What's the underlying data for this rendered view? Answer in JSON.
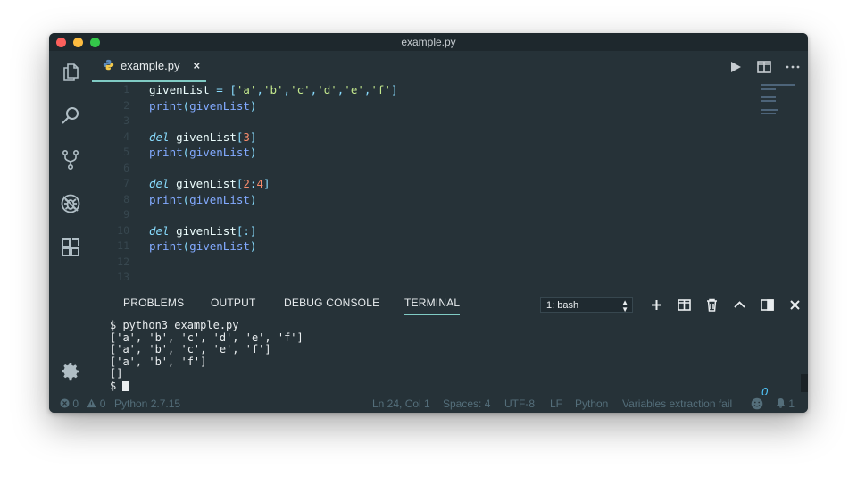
{
  "window": {
    "title": "example.py"
  },
  "activity_bar": {
    "items": [
      "explorer-icon",
      "search-icon",
      "source-control-icon",
      "debug-icon",
      "extensions-icon"
    ],
    "bottom": "settings-gear-icon"
  },
  "tab": {
    "label": "example.py",
    "close": "×"
  },
  "editor": {
    "line_numbers": [
      "1",
      "2",
      "3",
      "4",
      "5",
      "6",
      "7",
      "8",
      "9",
      "10",
      "11",
      "12",
      "13"
    ],
    "lines": [
      "givenList = ['a','b','c','d','e','f']",
      "print(givenList)",
      "",
      "del givenList[3]",
      "print(givenList)",
      "",
      "del givenList[2:4]",
      "print(givenList)",
      "",
      "del givenList[:]",
      "print(givenList)",
      "",
      ""
    ]
  },
  "panel": {
    "tabs": [
      "PROBLEMS",
      "OUTPUT",
      "DEBUG CONSOLE",
      "TERMINAL"
    ],
    "active_tab": "TERMINAL",
    "terminal_select": "1: bash",
    "terminal_lines": [
      "$ python3 example.py",
      "['a', 'b', 'c', 'd', 'e', 'f']",
      "['a', 'b', 'c', 'e', 'f']",
      "['a', 'b', 'f']",
      "[]",
      "$ "
    ],
    "status_mark": "0"
  },
  "statusbar": {
    "errors": "0",
    "warnings": "0",
    "interpreter": "Python 2.7.15",
    "position": "Ln 24, Col 1",
    "indent": "Spaces: 4",
    "encoding": "UTF-8",
    "eol": "LF",
    "language": "Python",
    "message": "Variables extraction fail",
    "notifications": "1"
  },
  "colors": {
    "background": "#263238",
    "accent": "#80cbc4",
    "keyword": "#89ddff",
    "string": "#c3e88d",
    "function": "#82aaff",
    "number": "#f78c6c"
  }
}
